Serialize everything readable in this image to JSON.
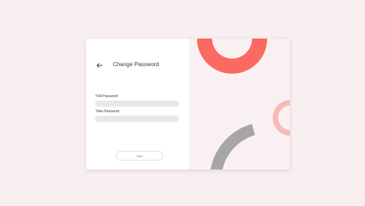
{
  "page": {
    "title": "Change Password"
  },
  "form": {
    "fields": [
      {
        "label": "Old Password",
        "required": true,
        "value": "",
        "placeholder": ""
      },
      {
        "label": "New Password",
        "required": true,
        "value": "",
        "placeholder": ""
      }
    ],
    "submit_label": "Save"
  },
  "icons": {
    "back": "arrow-left-icon"
  },
  "colors": {
    "background": "#f8f0f0",
    "card": "#ffffff",
    "field": "#e8e8e8",
    "accent_coral": "#fb6a62",
    "accent_pink": "#f7b9b9",
    "accent_gray": "#a6a6a6",
    "required": "#e34a4a"
  }
}
